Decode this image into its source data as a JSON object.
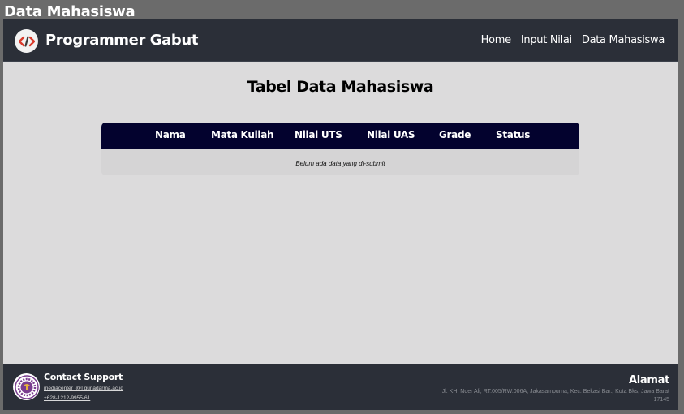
{
  "window": {
    "title": "Data Mahasiswa"
  },
  "navbar": {
    "logo_icon": "code-icon",
    "brand": "Programmer Gabut",
    "links": [
      {
        "label": "Home"
      },
      {
        "label": "Input Nilai"
      },
      {
        "label": "Data Mahasiswa"
      }
    ]
  },
  "main": {
    "heading": "Tabel Data Mahasiswa",
    "table": {
      "columns": [
        "Nama",
        "Mata Kuliah",
        "Nilai UTS",
        "Nilai UAS",
        "Grade",
        "Status"
      ],
      "empty_message": "Belum ada data yang di-submit"
    }
  },
  "footer": {
    "logo_icon": "university-seal-icon",
    "contact_title": "Contact Support",
    "contact_email": "mediacenter [@] gunadarma.ac.id",
    "contact_phone": "+628-1212-9955-61",
    "address_title": "Alamat",
    "address_text": "Jl. KH. Noer Ali, RT.005/RW.006A, Jakasampurna, Kec. Bekasi Bar., Kota Bks, Jawa Barat 17145"
  },
  "colors": {
    "navbar_bg": "#2b2f38",
    "table_header_bg": "#03022e",
    "page_bg": "#dcdbdc",
    "accent_red": "#d93a2b"
  }
}
